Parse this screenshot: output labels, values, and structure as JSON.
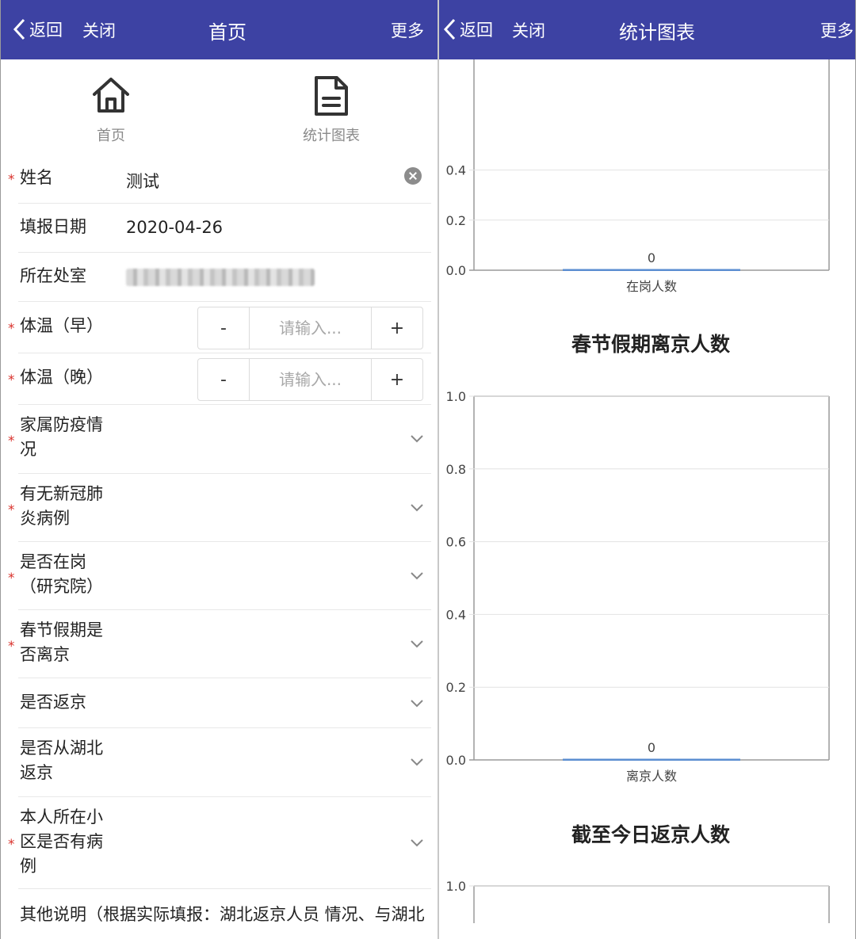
{
  "left": {
    "header": {
      "back_label": "返回",
      "close_label": "关闭",
      "title": "首页",
      "more_label": "更多"
    },
    "nav": [
      {
        "label": "首页",
        "icon": "home-icon"
      },
      {
        "label": "统计图表",
        "icon": "document-icon"
      }
    ],
    "form": {
      "required_mark": "*",
      "name": {
        "label": "姓名",
        "value": "测试"
      },
      "date": {
        "label": "填报日期",
        "value": "2020-04-26"
      },
      "department": {
        "label": "所在处室"
      },
      "temp_morning": {
        "label": "体温（早）",
        "placeholder": "请输入...",
        "minus": "-",
        "plus": "+"
      },
      "temp_evening": {
        "label": "体温（晚）",
        "placeholder": "请输入...",
        "minus": "-",
        "plus": "+"
      },
      "family": {
        "label_line1": "家属防疫情",
        "label_line2": "况"
      },
      "covid_case": {
        "label_line1": "有无新冠肺",
        "label_line2": "炎病例"
      },
      "on_duty": {
        "label_line1": "是否在岗",
        "label_line2": "（研究院）"
      },
      "left_beijing": {
        "label_line1": "春节假期是",
        "label_line2": "否离京"
      },
      "returned": {
        "label": "是否返京"
      },
      "from_hubei": {
        "label_line1": "是否从湖北",
        "label_line2": "返京"
      },
      "community": {
        "label_line1": "本人所在小",
        "label_line2": "区是否有病",
        "label_line3": "例"
      },
      "other": {
        "label": "其他说明（根据实际填报：湖北返京人员 情况、与湖北"
      }
    }
  },
  "right": {
    "header": {
      "back_label": "返回",
      "close_label": "关闭",
      "title": "统计图表",
      "more_label": "更多"
    }
  },
  "chart_data": [
    {
      "type": "bar",
      "title": "",
      "categories": [
        "在岗人数"
      ],
      "values": [
        0
      ],
      "data_labels": [
        "0"
      ],
      "ylim": [
        0,
        1
      ],
      "yticks_visible": [
        "0.0",
        "0.2",
        "0.4"
      ],
      "grid": true,
      "bar_color": "#5b8ed1"
    },
    {
      "type": "bar",
      "title": "春节假期离京人数",
      "categories": [
        "离京人数"
      ],
      "values": [
        0
      ],
      "data_labels": [
        "0"
      ],
      "ylim": [
        0,
        1
      ],
      "yticks": [
        "0.0",
        "0.2",
        "0.4",
        "0.6",
        "0.8",
        "1.0"
      ],
      "grid": true,
      "bar_color": "#5b8ed1"
    },
    {
      "type": "bar",
      "title": "截至今日返京人数",
      "categories": [],
      "values": [],
      "ylim": [
        0,
        1
      ],
      "yticks_visible": [
        "1.0"
      ],
      "grid": true
    }
  ],
  "colors": {
    "header_bg": "#3d42a3",
    "required": "#d9312b",
    "bar": "#5b8ed1"
  }
}
